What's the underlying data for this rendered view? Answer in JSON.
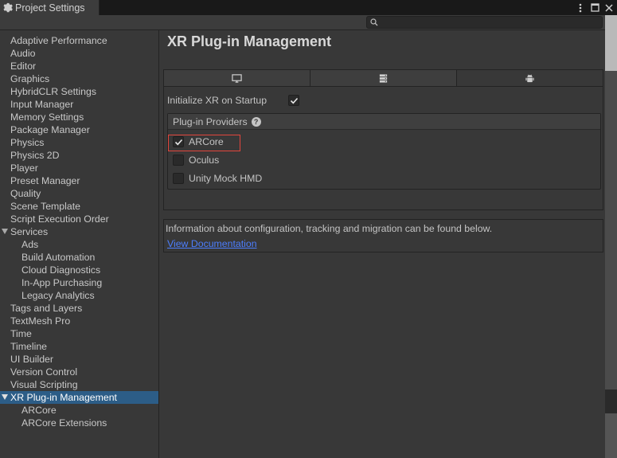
{
  "window": {
    "tab_title": "Project Settings",
    "icons": [
      "more-icon",
      "maximize-icon",
      "close-icon"
    ]
  },
  "search": {
    "placeholder": "",
    "value": ""
  },
  "sidebar": {
    "items": [
      {
        "label": "Adaptive Performance"
      },
      {
        "label": "Audio"
      },
      {
        "label": "Editor"
      },
      {
        "label": "Graphics"
      },
      {
        "label": "HybridCLR Settings"
      },
      {
        "label": "Input Manager"
      },
      {
        "label": "Memory Settings"
      },
      {
        "label": "Package Manager"
      },
      {
        "label": "Physics"
      },
      {
        "label": "Physics 2D"
      },
      {
        "label": "Player"
      },
      {
        "label": "Preset Manager"
      },
      {
        "label": "Quality"
      },
      {
        "label": "Scene Template"
      },
      {
        "label": "Script Execution Order"
      },
      {
        "label": "Services",
        "expanded": true
      },
      {
        "label": "Ads",
        "indent": 1
      },
      {
        "label": "Build Automation",
        "indent": 1
      },
      {
        "label": "Cloud Diagnostics",
        "indent": 1
      },
      {
        "label": "In-App Purchasing",
        "indent": 1
      },
      {
        "label": "Legacy Analytics",
        "indent": 1
      },
      {
        "label": "Tags and Layers"
      },
      {
        "label": "TextMesh Pro"
      },
      {
        "label": "Time"
      },
      {
        "label": "Timeline"
      },
      {
        "label": "UI Builder"
      },
      {
        "label": "Version Control"
      },
      {
        "label": "Visual Scripting"
      },
      {
        "label": "XR Plug-in Management",
        "expanded": true,
        "selected": true
      },
      {
        "label": "ARCore",
        "indent": 1
      },
      {
        "label": "ARCore Extensions",
        "indent": 1
      }
    ]
  },
  "main": {
    "title": "XR Plug-in Management",
    "platform_tabs": [
      {
        "icon": "desktop-icon",
        "active": false
      },
      {
        "icon": "server-icon",
        "active": false
      },
      {
        "icon": "android-icon",
        "active": true
      }
    ],
    "init_xr": {
      "label": "Initialize XR on Startup",
      "checked": true
    },
    "providers": {
      "header": "Plug-in Providers",
      "items": [
        {
          "label": "ARCore",
          "checked": true
        },
        {
          "label": "Oculus",
          "checked": false
        },
        {
          "label": "Unity Mock HMD",
          "checked": false
        }
      ]
    },
    "info": {
      "text": "Information about configuration, tracking and migration can be found below.",
      "link": "View Documentation"
    }
  },
  "colors": {
    "background": "#383838",
    "selection": "#2c5d87",
    "link": "#4c7eff",
    "highlight_outline": "#e2453c"
  }
}
